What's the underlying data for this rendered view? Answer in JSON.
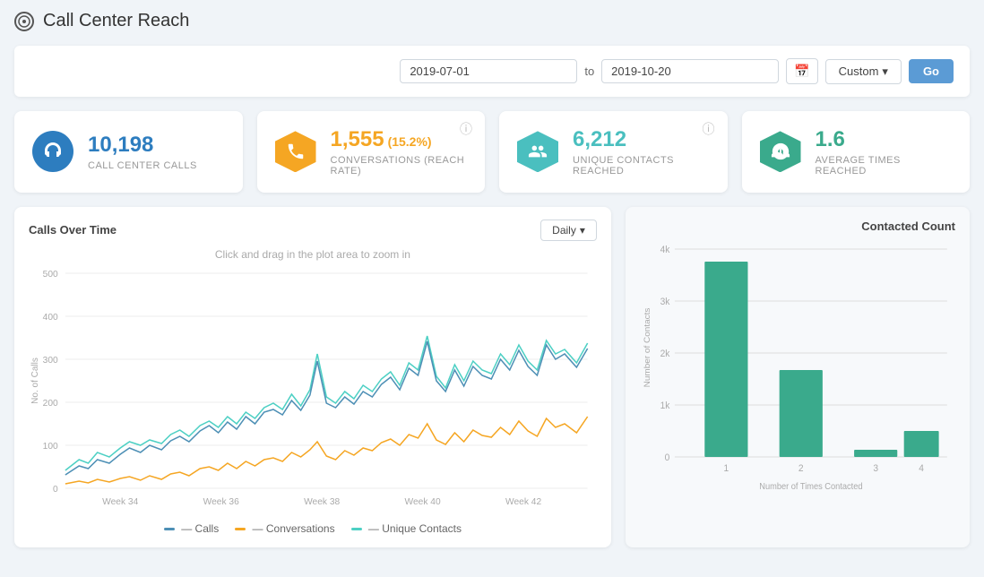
{
  "page": {
    "title": "Call Center Reach",
    "icon": "⊙"
  },
  "filter": {
    "date_from": "2019-07-01",
    "date_to": "2019-10-20",
    "to_label": "to",
    "custom_label": "Custom",
    "go_label": "Go"
  },
  "stats": [
    {
      "id": "calls",
      "value": "10,198",
      "rate": "",
      "label": "CALL CENTER CALLS",
      "icon": "headset",
      "color": "blue",
      "has_help": false
    },
    {
      "id": "conversations",
      "value": "1,555",
      "rate": "(15.2%)",
      "label": "CONVERSATIONS (REACH RATE)",
      "icon": "phone",
      "color": "orange",
      "has_help": true
    },
    {
      "id": "unique",
      "value": "6,212",
      "rate": "",
      "label": "UNIQUE CONTACTS REACHED",
      "icon": "users",
      "color": "teal",
      "has_help": true
    },
    {
      "id": "average",
      "value": "1.6",
      "rate": "",
      "label": "AVERAGE TIMES REACHED",
      "icon": "users-circle",
      "color": "green",
      "has_help": false
    }
  ],
  "line_chart": {
    "title": "Calls Over Time",
    "hint": "Click and drag in the plot area to zoom in",
    "daily_label": "Daily",
    "y_label": "No. of Calls",
    "x_ticks": [
      "Week 34",
      "Week 36",
      "Week 38",
      "Week 40",
      "Week 42"
    ],
    "y_ticks": [
      "500",
      "400",
      "300",
      "200",
      "100",
      "0"
    ],
    "legend": [
      {
        "label": "Calls",
        "color": "#4d8fb5"
      },
      {
        "label": "Conversations",
        "color": "#f5a623"
      },
      {
        "label": "Unique Contacts",
        "color": "#4dd0c4"
      }
    ]
  },
  "bar_chart": {
    "title": "Contacted Count",
    "y_label": "Number of Contacts",
    "x_label": "Number of Times Contacted",
    "x_ticks": [
      "1",
      "2",
      "3",
      "4"
    ],
    "y_ticks": [
      "4k",
      "3k",
      "2k",
      "1k",
      "0"
    ],
    "bars": [
      {
        "x": "1",
        "value": 3700,
        "height_pct": 0.92
      },
      {
        "x": "2",
        "value": 1650,
        "height_pct": 0.41
      },
      {
        "x": "3",
        "value": 130,
        "height_pct": 0.033
      },
      {
        "x": "4",
        "value": 480,
        "height_pct": 0.12
      }
    ],
    "bar_color": "#3aaa8c"
  }
}
